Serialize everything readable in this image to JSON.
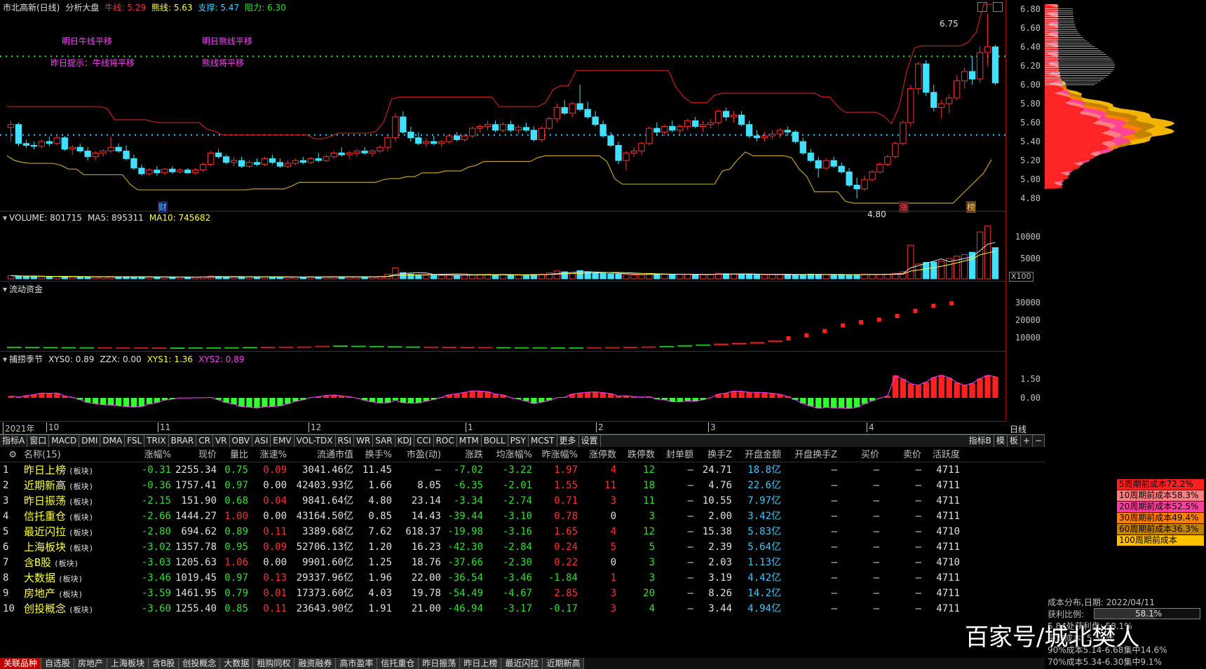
{
  "main_panel": {
    "title_items": [
      {
        "text": "市北高新(日线)",
        "color": "#e0e0e0"
      },
      {
        "text": "分析大盘",
        "color": "#e0e0e0"
      },
      {
        "text": "牛线: 5.29",
        "color": "#ff3030"
      },
      {
        "text": "熊线: 5.63",
        "color": "#ffff40"
      },
      {
        "text": "支撑: 5.47",
        "color": "#40c8ff"
      },
      {
        "text": "阻力: 6.30",
        "color": "#30e030"
      }
    ],
    "annotations": [
      "明日牛线平移",
      "明日熊线平移",
      "昨日提示：牛线将平移",
      "熊线将平移"
    ],
    "price_ticks": [
      "6.80",
      "6.60",
      "6.40",
      "6.20",
      "6.00",
      "5.80",
      "5.60",
      "5.40",
      "5.20",
      "5.00",
      "4.80"
    ],
    "high_label": "6.75",
    "low_label": "4.80",
    "markers": [
      "财",
      "涨",
      "榜"
    ]
  },
  "volume_panel": {
    "title_items": [
      {
        "text": "VOLUME: 801715",
        "color": "#e0e0e0"
      },
      {
        "text": "MA5: 895311",
        "color": "#e0e0e0"
      },
      {
        "text": "MA10: 745682",
        "color": "#ffff40"
      }
    ],
    "ticks": [
      "10000",
      "5000"
    ],
    "unit": "X100"
  },
  "flow_panel": {
    "title_items": [
      {
        "text": "流动资金",
        "color": "#e0e0e0"
      }
    ],
    "ticks": [
      "30000",
      "20000",
      "10000"
    ]
  },
  "season_panel": {
    "title_items": [
      {
        "text": "捕捞季节",
        "color": "#e0e0e0"
      },
      {
        "text": "XYS0: 0.89",
        "color": "#e0e0e0"
      },
      {
        "text": "ZZX: 0.00",
        "color": "#e0e0e0"
      },
      {
        "text": "XYS1: 1.36",
        "color": "#ffff40"
      },
      {
        "text": "XYS2: 0.89",
        "color": "#ff40ff"
      }
    ],
    "ticks": [
      "1.50",
      "0.00"
    ]
  },
  "time_axis": {
    "labels": [
      "2021年",
      "10",
      "11",
      "12",
      "1",
      "2",
      "3",
      "4"
    ],
    "period": "日线"
  },
  "indicator_tabs": [
    "指标A",
    "窗口",
    "MACD",
    "DMI",
    "DMA",
    "FSL",
    "TRIX",
    "BRAR",
    "CR",
    "VR",
    "OBV",
    "ASI",
    "EMV",
    "VOL-TDX",
    "RSI",
    "WR",
    "SAR",
    "KDJ",
    "CCI",
    "ROC",
    "MTM",
    "BOLL",
    "PSY",
    "MCST",
    "更多",
    "设置"
  ],
  "indicator_tabs_right": [
    "指标B",
    "模",
    "板",
    "+",
    "−"
  ],
  "table": {
    "headers": [
      "",
      "名称(15)",
      "涨幅%",
      "现价",
      "量比",
      "涨速%",
      "流通市值",
      "换手%",
      "市盈(动)",
      "涨跌",
      "均涨幅%",
      "昨涨幅%",
      "涨停数",
      "跌停数",
      "封单额",
      "换手Z",
      "开盘金额",
      "开盘换手Z",
      "买价",
      "卖价",
      "活跃度"
    ],
    "rows": [
      [
        "1",
        "昨日上榜",
        "(板块)",
        "-0.31",
        "2255.34",
        "0.75",
        "0.09",
        "3041.46亿",
        "11.45",
        "—",
        "-7.02",
        "-3.22",
        "1.97",
        "4",
        "12",
        "—",
        "24.71",
        "18.8亿",
        "—",
        "—",
        "—",
        "4711"
      ],
      [
        "2",
        "近期新高",
        "(板块)",
        "-0.36",
        "1757.41",
        "0.97",
        "0.00",
        "42403.93亿",
        "1.66",
        "8.05",
        "-6.35",
        "-2.01",
        "1.55",
        "11",
        "18",
        "—",
        "4.76",
        "22.6亿",
        "—",
        "—",
        "—",
        "4711"
      ],
      [
        "3",
        "昨日振荡",
        "(板块)",
        "-2.15",
        "151.90",
        "0.68",
        "0.04",
        "9841.64亿",
        "4.80",
        "23.14",
        "-3.34",
        "-2.74",
        "0.71",
        "3",
        "11",
        "—",
        "10.55",
        "7.97亿",
        "—",
        "—",
        "—",
        "4711"
      ],
      [
        "4",
        "信托重仓",
        "(板块)",
        "-2.66",
        "1444.27",
        "1.00",
        "0.00",
        "43164.50亿",
        "0.85",
        "14.43",
        "-39.44",
        "-3.10",
        "0.78",
        "0",
        "3",
        "—",
        "2.00",
        "3.42亿",
        "—",
        "—",
        "—",
        "4711"
      ],
      [
        "5",
        "最近闪拉",
        "(板块)",
        "-2.80",
        "694.62",
        "0.89",
        "0.11",
        "3389.68亿",
        "7.62",
        "618.37",
        "-19.98",
        "-3.16",
        "1.65",
        "4",
        "12",
        "—",
        "15.38",
        "5.83亿",
        "—",
        "—",
        "—",
        "4710"
      ],
      [
        "6",
        "上海板块",
        "(板块)",
        "-3.02",
        "1357.78",
        "0.95",
        "0.09",
        "52706.13亿",
        "1.20",
        "16.23",
        "-42.30",
        "-2.84",
        "0.24",
        "5",
        "5",
        "—",
        "2.39",
        "5.64亿",
        "—",
        "—",
        "—",
        "4711"
      ],
      [
        "7",
        "含B股",
        "(板块)",
        "-3.03",
        "1205.63",
        "1.06",
        "0.00",
        "9901.60亿",
        "1.25",
        "18.76",
        "-37.66",
        "-2.30",
        "0.22",
        "0",
        "3",
        "—",
        "2.03",
        "1.13亿",
        "—",
        "—",
        "—",
        "4710"
      ],
      [
        "8",
        "大数据",
        "(板块)",
        "-3.46",
        "1019.45",
        "0.97",
        "0.13",
        "29337.96亿",
        "1.96",
        "22.00",
        "-36.54",
        "-3.46",
        "-1.84",
        "1",
        "3",
        "—",
        "3.19",
        "4.42亿",
        "—",
        "—",
        "—",
        "4711"
      ],
      [
        "9",
        "房地产",
        "(板块)",
        "-3.59",
        "1461.95",
        "0.79",
        "0.01",
        "17373.60亿",
        "4.03",
        "19.78",
        "-54.49",
        "-4.67",
        "2.85",
        "3",
        "20",
        "—",
        "8.26",
        "14.2亿",
        "—",
        "—",
        "—",
        "4711"
      ],
      [
        "10",
        "创投概念",
        "(板块)",
        "-3.60",
        "1255.40",
        "0.85",
        "0.11",
        "23643.90亿",
        "1.91",
        "21.00",
        "-46.94",
        "-3.17",
        "-0.17",
        "3",
        "4",
        "—",
        "3.44",
        "4.94亿",
        "—",
        "—",
        "—",
        "4711"
      ]
    ]
  },
  "bottom_tabs": [
    "关联品种",
    "自选股",
    "房地产",
    "上海板块",
    "含B股",
    "创投概念",
    "大数据",
    "租购同权",
    "融资融券",
    "高市盈率",
    "信托重仓",
    "昨日振荡",
    "昨日上榜",
    "最近闪拉",
    "近期新高"
  ],
  "cost_distribution": {
    "legend": [
      {
        "text": "5周期前成本72.2%",
        "color": "#ff2020"
      },
      {
        "text": "10周期前成本58.3%",
        "color": "#ff8080"
      },
      {
        "text": "20周期前成本52.5%",
        "color": "#ff40a0"
      },
      {
        "text": "30周期前成本49.4%",
        "color": "#ff8000"
      },
      {
        "text": "60周期前成本36.3%",
        "color": "#c08000"
      },
      {
        "text": "100周期前成本28.6%",
        "color": "#ffc000"
      }
    ],
    "date_label": "成本分布,日期: 2022/04/11",
    "profit_label": "获利比例:",
    "profit_value": "58.1%",
    "line1": "5.84处获利盘: 58.1%",
    "line2": "平均成本: 5.54元",
    "line3": "90%成本5.14-6.68集中14.6%",
    "line4": "70%成本5.34-6.30集中9.1%"
  },
  "watermark": "百家号/城北樊人",
  "chart_data": {
    "type": "candlestick",
    "title": "市北高新(日线)",
    "ylim": [
      4.75,
      6.85
    ],
    "ohlc": [
      [
        5.55,
        5.62,
        5.4,
        5.58
      ],
      [
        5.58,
        5.6,
        5.35,
        5.38
      ],
      [
        5.38,
        5.42,
        5.33,
        5.36
      ],
      [
        5.36,
        5.4,
        5.32,
        5.35
      ],
      [
        5.35,
        5.42,
        5.33,
        5.4
      ],
      [
        5.4,
        5.45,
        5.35,
        5.38
      ],
      [
        5.38,
        5.48,
        5.36,
        5.44
      ],
      [
        5.44,
        5.46,
        5.3,
        5.32
      ],
      [
        5.32,
        5.36,
        5.26,
        5.34
      ],
      [
        5.34,
        5.38,
        5.28,
        5.3
      ],
      [
        5.3,
        5.34,
        5.2,
        5.24
      ],
      [
        5.24,
        5.3,
        5.2,
        5.28
      ],
      [
        5.28,
        5.32,
        5.24,
        5.3
      ],
      [
        5.3,
        5.45,
        5.28,
        5.34
      ],
      [
        5.34,
        5.38,
        5.28,
        5.3
      ],
      [
        5.3,
        5.36,
        5.2,
        5.22
      ],
      [
        5.22,
        5.26,
        5.1,
        5.12
      ],
      [
        5.12,
        5.16,
        5.04,
        5.06
      ],
      [
        5.06,
        5.12,
        5.04,
        5.1
      ],
      [
        5.1,
        5.14,
        5.04,
        5.07
      ],
      [
        5.07,
        5.12,
        5.05,
        5.11
      ],
      [
        5.11,
        5.14,
        5.06,
        5.08
      ],
      [
        5.08,
        5.12,
        5.06,
        5.1
      ],
      [
        5.1,
        5.12,
        5.06,
        5.07
      ],
      [
        5.07,
        5.12,
        5.05,
        5.1
      ],
      [
        5.1,
        5.18,
        5.08,
        5.16
      ],
      [
        5.16,
        5.3,
        5.14,
        5.28
      ],
      [
        5.28,
        5.32,
        5.22,
        5.24
      ],
      [
        5.24,
        5.26,
        5.16,
        5.18
      ],
      [
        5.18,
        5.24,
        5.14,
        5.2
      ],
      [
        5.2,
        5.24,
        5.12,
        5.14
      ],
      [
        5.14,
        5.2,
        5.12,
        5.18
      ],
      [
        5.18,
        5.22,
        5.14,
        5.16
      ],
      [
        5.16,
        5.24,
        5.14,
        5.22
      ],
      [
        5.22,
        5.26,
        5.16,
        5.18
      ],
      [
        5.18,
        5.22,
        5.12,
        5.14
      ],
      [
        5.14,
        5.2,
        5.12,
        5.17
      ],
      [
        5.17,
        5.22,
        5.15,
        5.2
      ],
      [
        5.2,
        5.24,
        5.16,
        5.18
      ],
      [
        5.18,
        5.24,
        5.16,
        5.22
      ],
      [
        5.22,
        5.28,
        5.18,
        5.2
      ],
      [
        5.2,
        5.26,
        5.18,
        5.24
      ],
      [
        5.24,
        5.3,
        5.22,
        5.28
      ],
      [
        5.28,
        5.34,
        5.24,
        5.26
      ],
      [
        5.26,
        5.3,
        5.22,
        5.28
      ],
      [
        5.28,
        5.32,
        5.24,
        5.3
      ],
      [
        5.3,
        5.34,
        5.26,
        5.28
      ],
      [
        5.28,
        5.32,
        5.24,
        5.3
      ],
      [
        5.3,
        5.36,
        5.28,
        5.34
      ],
      [
        5.34,
        5.46,
        5.3,
        5.44
      ],
      [
        5.44,
        5.7,
        5.4,
        5.66
      ],
      [
        5.66,
        5.72,
        5.48,
        5.5
      ],
      [
        5.5,
        5.56,
        5.4,
        5.44
      ],
      [
        5.44,
        5.5,
        5.36,
        5.38
      ],
      [
        5.38,
        5.44,
        5.34,
        5.4
      ],
      [
        5.4,
        5.46,
        5.36,
        5.38
      ],
      [
        5.38,
        5.42,
        5.34,
        5.4
      ],
      [
        5.4,
        5.48,
        5.38,
        5.46
      ],
      [
        5.46,
        5.5,
        5.4,
        5.42
      ],
      [
        5.42,
        5.48,
        5.4,
        5.46
      ],
      [
        5.46,
        5.56,
        5.44,
        5.54
      ],
      [
        5.54,
        5.58,
        5.5,
        5.56
      ],
      [
        5.56,
        5.62,
        5.52,
        5.58
      ],
      [
        5.58,
        5.62,
        5.5,
        5.52
      ],
      [
        5.52,
        5.6,
        5.5,
        5.58
      ],
      [
        5.58,
        5.62,
        5.5,
        5.52
      ],
      [
        5.52,
        5.58,
        5.48,
        5.55
      ],
      [
        5.55,
        5.6,
        5.5,
        5.52
      ],
      [
        5.52,
        5.56,
        5.4,
        5.42
      ],
      [
        5.42,
        5.56,
        5.4,
        5.54
      ],
      [
        5.54,
        5.66,
        5.52,
        5.64
      ],
      [
        5.64,
        5.8,
        5.6,
        5.76
      ],
      [
        5.76,
        5.84,
        5.68,
        5.7
      ],
      [
        5.7,
        5.82,
        5.66,
        5.8
      ],
      [
        5.8,
        6.0,
        5.72,
        5.74
      ],
      [
        5.74,
        5.82,
        5.64,
        5.66
      ],
      [
        5.66,
        5.72,
        5.56,
        5.58
      ],
      [
        5.58,
        5.62,
        5.44,
        5.46
      ],
      [
        5.46,
        5.5,
        5.34,
        5.36
      ],
      [
        5.36,
        5.4,
        5.16,
        5.2
      ],
      [
        5.2,
        5.3,
        5.1,
        5.28
      ],
      [
        5.28,
        5.34,
        5.24,
        5.3
      ],
      [
        5.3,
        5.4,
        5.26,
        5.38
      ],
      [
        5.38,
        5.56,
        5.36,
        5.54
      ],
      [
        5.54,
        5.6,
        5.46,
        5.5
      ],
      [
        5.5,
        5.58,
        5.46,
        5.56
      ],
      [
        5.56,
        5.62,
        5.5,
        5.52
      ],
      [
        5.52,
        5.58,
        5.48,
        5.56
      ],
      [
        5.56,
        5.64,
        5.52,
        5.62
      ],
      [
        5.62,
        5.66,
        5.54,
        5.56
      ],
      [
        5.56,
        5.62,
        5.5,
        5.58
      ],
      [
        5.58,
        5.64,
        5.54,
        5.6
      ],
      [
        5.6,
        5.74,
        5.58,
        5.72
      ],
      [
        5.72,
        5.76,
        5.62,
        5.66
      ],
      [
        5.66,
        5.72,
        5.6,
        5.68
      ],
      [
        5.68,
        5.72,
        5.56,
        5.58
      ],
      [
        5.58,
        5.62,
        5.44,
        5.46
      ],
      [
        5.46,
        5.52,
        5.4,
        5.44
      ],
      [
        5.44,
        5.5,
        5.4,
        5.46
      ],
      [
        5.46,
        5.52,
        5.42,
        5.48
      ],
      [
        5.48,
        5.54,
        5.44,
        5.52
      ],
      [
        5.52,
        5.56,
        5.46,
        5.5
      ],
      [
        5.5,
        5.52,
        5.38,
        5.4
      ],
      [
        5.4,
        5.44,
        5.26,
        5.28
      ],
      [
        5.28,
        5.32,
        5.18,
        5.2
      ],
      [
        5.2,
        5.24,
        5.02,
        5.12
      ],
      [
        5.12,
        5.22,
        5.1,
        5.2
      ],
      [
        5.2,
        5.24,
        5.12,
        5.14
      ],
      [
        5.14,
        5.18,
        5.06,
        5.08
      ],
      [
        5.08,
        5.12,
        4.92,
        4.94
      ],
      [
        4.94,
        5.02,
        4.8,
        4.9
      ],
      [
        4.9,
        5.04,
        4.88,
        5.0
      ],
      [
        5.0,
        5.1,
        4.98,
        5.08
      ],
      [
        5.08,
        5.18,
        5.06,
        5.16
      ],
      [
        5.16,
        5.26,
        5.14,
        5.24
      ],
      [
        5.24,
        5.4,
        5.22,
        5.38
      ],
      [
        5.38,
        5.62,
        5.36,
        5.6
      ],
      [
        5.6,
        6.0,
        5.56,
        5.96
      ],
      [
        5.96,
        6.24,
        5.9,
        6.22
      ],
      [
        6.22,
        6.26,
        5.88,
        5.92
      ],
      [
        5.92,
        6.0,
        5.72,
        5.76
      ],
      [
        5.76,
        5.84,
        5.64,
        5.8
      ],
      [
        5.8,
        5.9,
        5.7,
        5.86
      ],
      [
        5.86,
        6.1,
        5.84,
        6.04
      ],
      [
        6.04,
        6.18,
        5.96,
        6.14
      ],
      [
        6.14,
        6.3,
        6.0,
        6.06
      ],
      [
        6.06,
        6.4,
        6.02,
        6.34
      ],
      [
        6.34,
        6.75,
        6.2,
        6.4
      ],
      [
        6.4,
        6.42,
        6.0,
        6.02
      ]
    ],
    "volume": [
      80,
      70,
      60,
      65,
      55,
      50,
      60,
      55,
      50,
      45,
      50,
      48,
      52,
      60,
      50,
      55,
      48,
      45,
      50,
      42,
      46,
      40,
      44,
      42,
      45,
      50,
      70,
      60,
      52,
      48,
      50,
      45,
      48,
      52,
      46,
      44,
      48,
      46,
      44,
      50,
      48,
      52,
      55,
      50,
      48,
      46,
      50,
      52,
      60,
      120,
      280,
      160,
      120,
      100,
      90,
      95,
      88,
      100,
      90,
      92,
      110,
      115,
      120,
      105,
      110,
      100,
      95,
      98,
      110,
      120,
      150,
      200,
      180,
      160,
      210,
      170,
      150,
      140,
      130,
      120,
      110,
      100,
      105,
      130,
      125,
      118,
      110,
      115,
      120,
      112,
      108,
      110,
      140,
      130,
      125,
      120,
      115,
      110,
      105,
      108,
      112,
      105,
      100,
      110,
      120,
      115,
      110,
      108,
      105,
      100,
      110,
      120,
      118,
      115,
      120,
      140,
      180,
      860,
      380,
      420,
      430,
      450,
      520,
      580,
      620,
      680,
      1200,
      1350,
      800
    ],
    "flow": [
      600,
      500,
      400,
      300,
      200,
      200,
      100,
      100,
      0,
      0,
      100,
      100,
      200,
      400,
      600,
      700,
      800,
      1300,
      1600,
      1400,
      1200,
      1000,
      800,
      700,
      600,
      500,
      400,
      300,
      200,
      200,
      100,
      100,
      200,
      300,
      500,
      800,
      1200,
      1800,
      2400,
      3000,
      3600,
      4200,
      5400,
      7200,
      9600,
      13000,
      17500,
      20000,
      22000,
      25000,
      29000,
      33000,
      35000
    ]
  }
}
